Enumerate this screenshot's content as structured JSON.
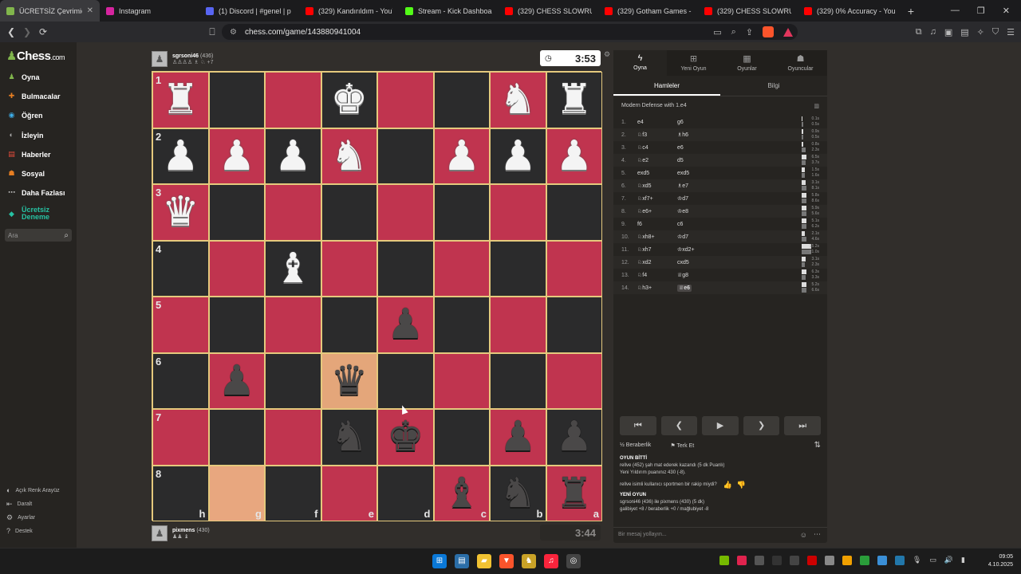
{
  "browser": {
    "tabs": [
      {
        "title": "ÜCRETSİZ Çevrimiç",
        "active": true,
        "color": "#81b64c"
      },
      {
        "title": "Instagram",
        "active": false,
        "color": "#d6249f"
      },
      {
        "title": "(1) Discord | #genel | p",
        "active": false,
        "color": "#5865f2"
      },
      {
        "title": "(329) Kandırıldım - YouT",
        "active": false,
        "color": "#ff0000"
      },
      {
        "title": "Stream - Kick Dashboard",
        "active": false,
        "color": "#53fc18"
      },
      {
        "title": "(329) CHESS SLOWRUN EF",
        "active": false,
        "color": "#ff0000"
      },
      {
        "title": "(329) Gotham Games - Yo",
        "active": false,
        "color": "#ff0000"
      },
      {
        "title": "(329) CHESS SLOWRUN (E",
        "active": false,
        "color": "#ff0000"
      },
      {
        "title": "(329) 0% Accuracy - YouTu",
        "active": false,
        "color": "#ff0000"
      }
    ],
    "url": "chess.com/game/143880941004",
    "new_tab": "+"
  },
  "sidebar": {
    "logo_main": "Chess",
    "logo_suffix": ".com",
    "items": [
      {
        "label": "Oyna",
        "color": "#81b64c"
      },
      {
        "label": "Bulmacalar",
        "color": "#e67e22"
      },
      {
        "label": "Öğren",
        "color": "#3daee9"
      },
      {
        "label": "İzleyin",
        "color": "#aaa"
      },
      {
        "label": "Haberler",
        "color": "#e74c3c"
      },
      {
        "label": "Sosyal",
        "color": "#e67e22"
      },
      {
        "label": "Daha Fazlası",
        "color": "#bbb"
      },
      {
        "label": "Ücretsiz Deneme",
        "color": "#26c2a3"
      }
    ],
    "search_placeholder": "Ara",
    "bottom": [
      "Açık Renk Arayüz",
      "Daralt",
      "Ayarlar",
      "Destek"
    ]
  },
  "top_player": {
    "name": "sgrsoni46",
    "rating": "(436)",
    "captured": "♙♙♙♙ ♗ ♘ +7",
    "clock": "3:53"
  },
  "bottom_player": {
    "name": "pixmens",
    "rating": "(430)",
    "captured": "♟♟ ♝",
    "clock": "3:44"
  },
  "board": {
    "ranks": [
      "1",
      "2",
      "3",
      "4",
      "5",
      "6",
      "7",
      "8"
    ],
    "files": [
      "h",
      "g",
      "f",
      "e",
      "d",
      "c",
      "b",
      "a"
    ],
    "rows": [
      [
        "wR",
        "",
        "",
        "wK",
        "",
        "",
        "wN",
        "wR"
      ],
      [
        "wP",
        "wP",
        "wP",
        "wN",
        "",
        "wP",
        "wP",
        "wP"
      ],
      [
        "wQ",
        "",
        "",
        "",
        "",
        "",
        "",
        ""
      ],
      [
        "",
        "",
        "wB",
        "",
        "",
        "",
        "",
        ""
      ],
      [
        "",
        "",
        "",
        "",
        "bP",
        "",
        "",
        ""
      ],
      [
        "",
        "bP",
        "",
        "bQ",
        "",
        "",
        "",
        ""
      ],
      [
        "",
        "",
        "",
        "bN",
        "bK",
        "",
        "bP",
        "bP"
      ],
      [
        "",
        "",
        "",
        "",
        "",
        "bB",
        "bN",
        "bR"
      ]
    ],
    "highlights": [
      [
        5,
        3
      ],
      [
        7,
        1
      ]
    ]
  },
  "panel": {
    "tabs": [
      "Oyna",
      "Yeni Oyun",
      "Oyunlar",
      "Oyuncular"
    ],
    "subtabs": [
      "Hamleler",
      "Bilgi"
    ],
    "opening": "Modern Defense with 1.e4",
    "moves": [
      {
        "n": "1.",
        "w": "e4",
        "b": "g6",
        "tw": "0.1s",
        "tb": "0.5s",
        "bw": 0.1,
        "bb": 0.3
      },
      {
        "n": "2.",
        "w": "♘f3",
        "b": "♗h6",
        "tw": "0.9s",
        "tb": "0.5s",
        "bw": 0.4,
        "bb": 0.3
      },
      {
        "n": "3.",
        "w": "♘c4",
        "b": "e6",
        "tw": "0.8s",
        "tb": "2.3s",
        "bw": 0.4,
        "bb": 0.8
      },
      {
        "n": "4.",
        "w": "♘e2",
        "b": "d5",
        "tw": "6.5s",
        "tb": "3.7s",
        "bw": 1.0,
        "bb": 0.8
      },
      {
        "n": "5.",
        "w": "exd5",
        "b": "exd5",
        "tw": "1.5s",
        "tb": "1.6s",
        "bw": 0.6,
        "bb": 0.6
      },
      {
        "n": "6.",
        "w": "♘xd5",
        "b": "♗e7",
        "tw": "3.1s",
        "tb": "8.1s",
        "bw": 0.8,
        "bb": 1.0
      },
      {
        "n": "7.",
        "w": "♘xf7+",
        "b": "♔d7",
        "tw": "5.8s",
        "tb": "8.6s",
        "bw": 1.0,
        "bb": 1.0
      },
      {
        "n": "8.",
        "w": "♘e6+",
        "b": "♔e8",
        "tw": "5.9s",
        "tb": "5.6s",
        "bw": 1.0,
        "bb": 1.0
      },
      {
        "n": "9.",
        "w": "f6",
        "b": "c6",
        "tw": "5.1s",
        "tb": "6.2s",
        "bw": 1.0,
        "bb": 1.0
      },
      {
        "n": "10.",
        "w": "♘xh8+",
        "b": "♔d7",
        "tw": "2.1s",
        "tb": "4.6s",
        "bw": 0.7,
        "bb": 1.0
      },
      {
        "n": "11.",
        "w": "♘xh7",
        "b": "♔xd2+",
        "tw": "15.2s",
        "tb": "21.0s",
        "bw": 2.0,
        "bb": 2.0
      },
      {
        "n": "12.",
        "w": "♘xd2",
        "b": "cxd5",
        "tw": "3.1s",
        "tb": "2.3s",
        "bw": 0.8,
        "bb": 0.7
      },
      {
        "n": "13.",
        "w": "♘f4",
        "b": "♕g8",
        "tw": "6.3s",
        "tb": "3.3s",
        "bw": 1.0,
        "bb": 0.8
      },
      {
        "n": "14.",
        "w": "♘h3+",
        "b": "♕e6",
        "tw": "5.2s",
        "tb": "6.6s",
        "bw": 1.0,
        "bb": 1.0
      }
    ],
    "actions": {
      "draw": "Beraberlik",
      "resign": "Terk Et"
    },
    "chat": {
      "game_over_label": "OYUN BİTTİ",
      "line1": "rellve (452) şah mat ederek kazandı (5 dk Puanlı)",
      "line2": "Yeni Yıldırım puanınız 430 (-8).",
      "line3": "rellve isimli kullanıcı sportmen bir rakip miydi?",
      "new_game": "YENİ OYUN",
      "line4": "sgrsoni46 (436) ile pixmens (430) (5 dk)",
      "line5": "galibiyet +8 / beraberlik +0 / mağlubiyet -8"
    },
    "chat_placeholder": "Bir mesaj yollayın..."
  },
  "taskbar": {
    "time": "09:05",
    "date": "4.10.2025"
  },
  "colors": {
    "dark_square": "#2b2b2c",
    "light_square": "#c0344f",
    "board_border": "#e5c97d"
  }
}
